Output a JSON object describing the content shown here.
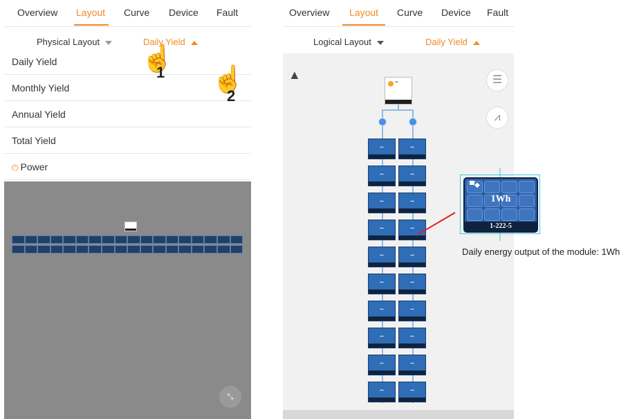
{
  "left": {
    "tabs": [
      "Overview",
      "Layout",
      "Curve",
      "Device",
      "Fault"
    ],
    "active_tab": "Layout",
    "layout_select": "Physical Layout",
    "metric_select": "Daily Yield",
    "menu": [
      "Daily Yield",
      "Monthly Yield",
      "Annual Yield",
      "Total Yield",
      "Power"
    ],
    "steps": [
      "1",
      "2"
    ]
  },
  "right": {
    "tabs": [
      "Overview",
      "Layout",
      "Curve",
      "Device",
      "Fault"
    ],
    "active_tab": "Layout",
    "layout_select": "Logical Layout",
    "metric_select": "Daily Yield",
    "zoom_value": "1Wh",
    "zoom_label": "1-222-5",
    "caption": "Daily energy output of the module: 1Wh"
  },
  "icons": {
    "compass": "compass-icon",
    "list": "list-icon",
    "curve": "curve-icon",
    "expand": "expand-icon",
    "hand": "pointing-hand-icon"
  },
  "colors": {
    "accent": "#f08a24",
    "module": "#2f6db6",
    "highlight": "#46c3e6",
    "pointer": "#e02020"
  }
}
